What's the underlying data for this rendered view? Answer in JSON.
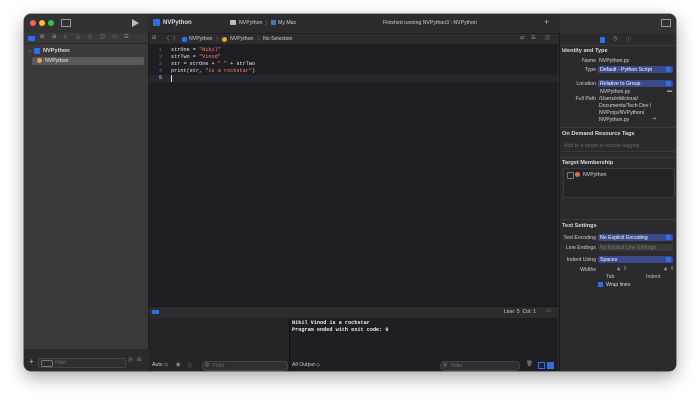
{
  "toolbar": {
    "project_name": "NVPython",
    "scheme": "NVPython",
    "destination": "My Mac",
    "status": "Finished running NVPython3 : NVPython"
  },
  "jumpbar": {
    "crumb1": "NVPython",
    "crumb2": "NVPython",
    "crumb3": "No Selection"
  },
  "navigator": {
    "project": "NVPython",
    "file": "NVPython",
    "filter_placeholder": "Filter"
  },
  "editor": {
    "lines": [
      {
        "num": "1",
        "code": "strOne = \"Nikil\""
      },
      {
        "num": "2",
        "code": "strTwo = \"Vinod\""
      },
      {
        "num": "3",
        "code": "str = strOne + \" \" + strTwo"
      },
      {
        "num": "4",
        "code": "print(str, \"is a rockstar\")"
      },
      {
        "num": "5",
        "code": ""
      }
    ],
    "cursor_status": "Line: 5  Col: 1"
  },
  "debug": {
    "console_lines": [
      "Nikil Vinod is a rockstar",
      "Program ended with exit code: 0"
    ],
    "auto_label": "Auto ◇",
    "filter_left": "Filter",
    "output_label": "All Output ◇",
    "filter_right": "Filter"
  },
  "inspector": {
    "identity_title": "Identity and Type",
    "name_label": "Name",
    "name_value": "NVPython.py",
    "type_label": "Type",
    "type_value": "Default - Python Script",
    "location_label": "Location",
    "location_value": "Relative to Group",
    "location_file": "NVPython.py",
    "fullpath_label": "Full Path",
    "fullpath_value": [
      "/Users/nikilcious/",
      "Documents/Tech Dev /",
      "NVProjs/NVPython/",
      "NVPython.py"
    ],
    "ondemand_title": "On Demand Resource Tags",
    "ondemand_placeholder": "Add to a target to enable tagging",
    "target_title": "Target Membership",
    "target_item": "NVPython",
    "text_title": "Text Settings",
    "encoding_label": "Text Encoding",
    "encoding_value": "No Explicit Encoding",
    "lineendings_label": "Line Endings",
    "lineendings_value": "No Explicit Line Endings",
    "indent_label": "Indent Using",
    "indent_value": "Spaces",
    "widths_label": "Widths",
    "tab_width": "4",
    "indent_width": "4",
    "tab_label": "Tab",
    "indent_label2": "Indent",
    "wrap_label": "Wrap lines"
  },
  "colors": {
    "accent": "#2f6fe0",
    "selection": "#3a4a8c",
    "string": "#ff8170"
  }
}
